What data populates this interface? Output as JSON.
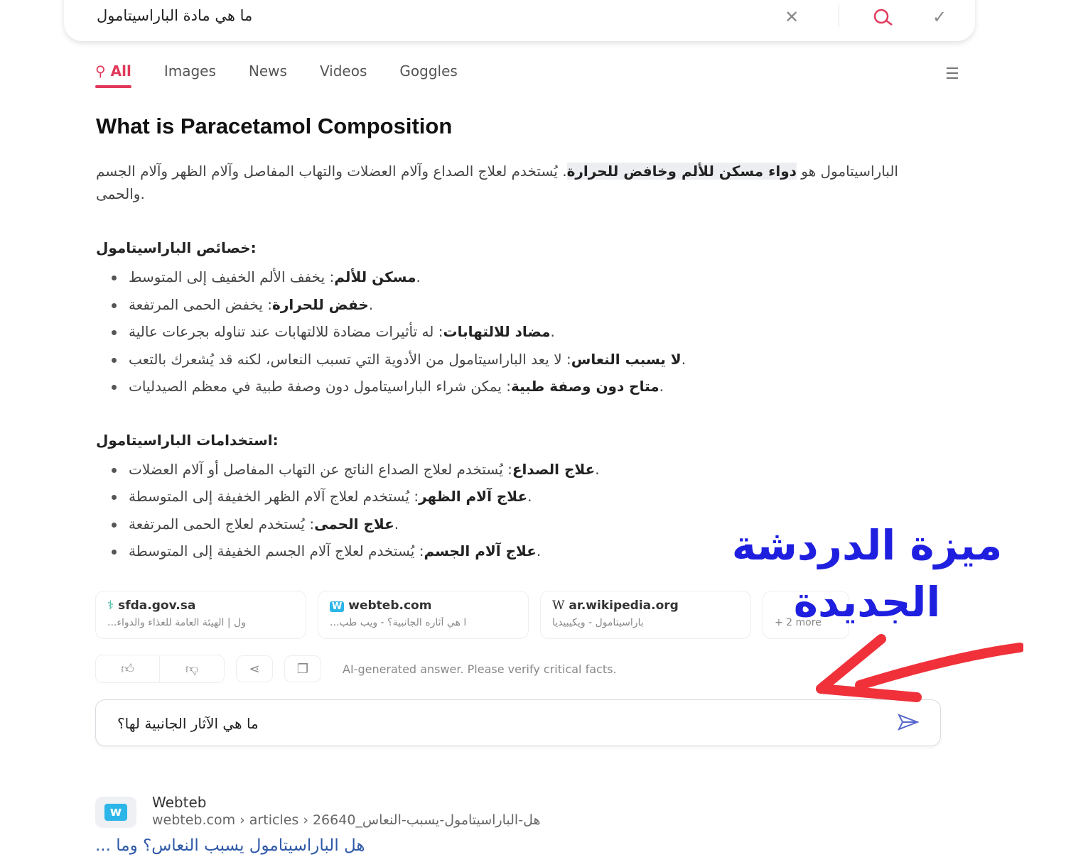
{
  "search": {
    "query": "ما هي مادة الباراسيتامول",
    "clear_icon": "close-icon",
    "search_icon": "search-icon",
    "confirm_icon": "check-icon"
  },
  "tabs": [
    {
      "label": "All",
      "active": true
    },
    {
      "label": "Images"
    },
    {
      "label": "News"
    },
    {
      "label": "Videos"
    },
    {
      "label": "Goggles"
    }
  ],
  "answer": {
    "title": "What is Paracetamol Composition",
    "intro_pre": "الباراسيتامول هو ",
    "intro_hl": "دواء مسكن للألم وخافض للحرارة",
    "intro_post": ". يُستخدم لعلاج الصداع وآلام العضلات والتهاب المفاصل وآلام الظهر وآلام الجسم والحمى.",
    "sections": [
      {
        "heading": "خصائص الباراسيتامول:",
        "items": [
          {
            "b": "مسكن للألم",
            "t": ": يخفف الألم الخفيف إلى المتوسط."
          },
          {
            "b": "خفض للحرارة",
            "t": ": يخفض الحمى المرتفعة."
          },
          {
            "b": "مضاد للالتهابات",
            "t": ": له تأثيرات مضادة للالتهابات عند تناوله بجرعات عالية."
          },
          {
            "b": "لا يسبب النعاس",
            "t": ": لا يعد الباراسيتامول من الأدوية التي تسبب النعاس، لكنه قد يُشعرك بالتعب."
          },
          {
            "b": "متاح دون وصفة طبية",
            "t": ": يمكن شراء الباراسيتامول دون وصفة طبية في معظم الصيدليات."
          }
        ]
      },
      {
        "heading": "استخدامات الباراسيتامول:",
        "items": [
          {
            "b": "علاج الصداع",
            "t": ": يُستخدم لعلاج الصداع الناتج عن التهاب المفاصل أو آلام العضلات."
          },
          {
            "b": "علاج آلام الظهر",
            "t": ": يُستخدم لعلاج آلام الظهر الخفيفة إلى المتوسطة."
          },
          {
            "b": "علاج الحمى",
            "t": ": يُستخدم لعلاج الحمى المرتفعة."
          },
          {
            "b": "علاج آلام الجسم",
            "t": ": يُستخدم لعلاج آلام الجسم الخفيفة إلى المتوسطة."
          }
        ]
      }
    ]
  },
  "sources": [
    {
      "domain": "sfda.gov.sa",
      "snippet": "...ول | الهيئة العامة للغذاء والدواء"
    },
    {
      "domain": "webteb.com",
      "snippet": "...ا هي آثاره الجانبية؟ - ويب طب"
    },
    {
      "domain": "ar.wikipedia.org",
      "snippet": "باراسيتامول - ويكيبيديا"
    }
  ],
  "more_sources": "+ 2 more",
  "disclaimer": "AI-generated answer. Please verify critical facts.",
  "chat_input": {
    "value": "ما هي الآثار الجانبية لها؟"
  },
  "result": {
    "name": "Webteb",
    "url": "webteb.com › articles › 26640_هل-الباراسيتامول-يسبب-النعاس",
    "title": "... هل الباراسيتامول يسبب النعاس؟ وما"
  },
  "annotation": {
    "text": "ميزة الدردشة الجديدة",
    "color": "#1f1fe0",
    "arrow_color": "#f0313a"
  },
  "colors": {
    "accent": "#e0395b",
    "link": "#2f5aa8"
  }
}
